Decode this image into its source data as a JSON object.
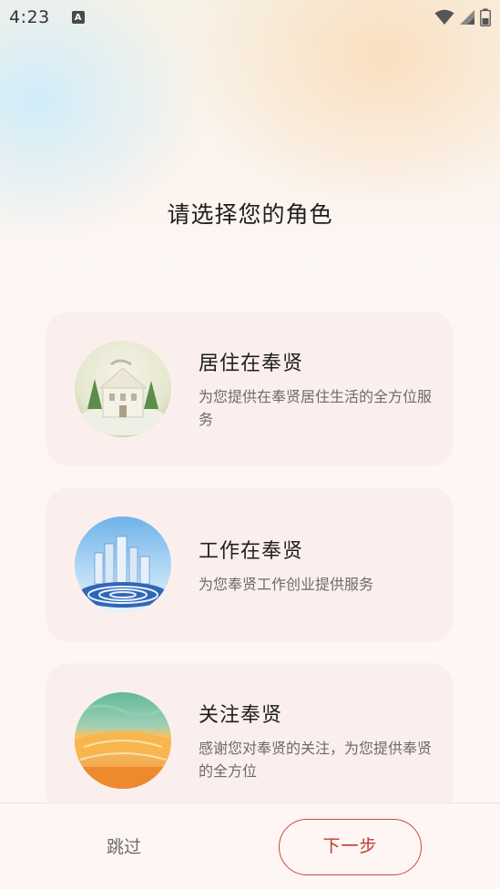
{
  "status_bar": {
    "time": "4:23",
    "indicator": "A",
    "icons": [
      "wifi-icon",
      "signal-icon",
      "battery-icon"
    ]
  },
  "page": {
    "title": "请选择您的角色"
  },
  "roles": [
    {
      "title": "居住在奉贤",
      "description": "为您提供在奉贤居住生活的全方位服务",
      "image": "residence-house-image"
    },
    {
      "title": "工作在奉贤",
      "description": "为您奉贤工作创业提供服务",
      "image": "work-city-skyline-image"
    },
    {
      "title": "关注奉贤",
      "description": "感谢您对奉贤的关注，为您提供奉贤的全方位",
      "image": "follow-landmark-image"
    }
  ],
  "footer": {
    "skip_label": "跳过",
    "next_label": "下一步"
  },
  "colors": {
    "accent": "#c2392d",
    "card_background": "#fbefee",
    "page_background": "#fdf6f5"
  }
}
